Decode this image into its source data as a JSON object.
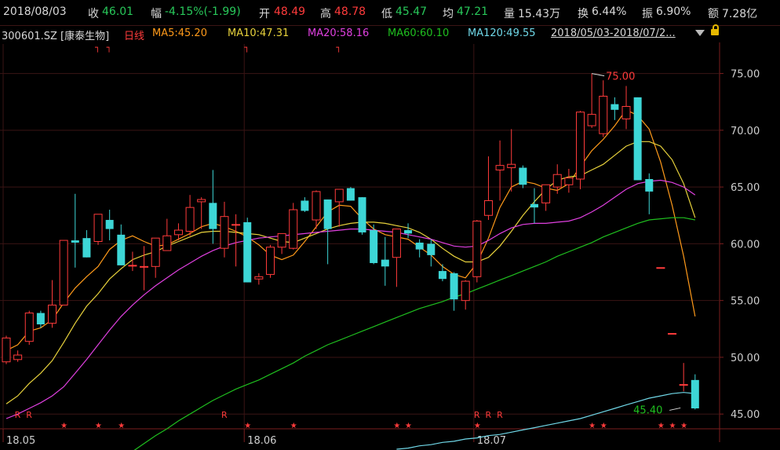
{
  "info": {
    "date": "2018/08/03",
    "close_label": "收",
    "close_value": "46.01",
    "change_label": "幅",
    "change_value": "-4.15%(-1.99)",
    "open_label": "开",
    "open_value": "48.49",
    "high_label": "高",
    "high_value": "48.78",
    "low_label": "低",
    "low_value": "45.47",
    "avg_label": "均",
    "avg_value": "47.21",
    "volume_label": "量",
    "volume_value": "15.43万",
    "turnover_label": "换",
    "turnover_value": "6.44%",
    "amplitude_label": "振",
    "amplitude_value": "6.90%",
    "amount_label": "额",
    "amount_value": "7.28亿"
  },
  "legend": {
    "stock": "300601.SZ [康泰生物]",
    "period": "日线",
    "ma5": "MA5:45.20",
    "ma10": "MA10:47.31",
    "ma20": "MA20:58.16",
    "ma60": "MA60:60.10",
    "ma120": "MA120:49.55",
    "range": "2018/05/03-2018/07/2..."
  },
  "colors": {
    "up": "#ff3b3b",
    "down": "#3dd6d6",
    "ma5": "#ff9a1a",
    "ma10": "#e8d23c",
    "ma20": "#e040e0",
    "ma60": "#1fbf1f",
    "ma120": "#70d8e8",
    "grid": "#3a1414",
    "axis": "#7a1e1e"
  },
  "chart_data": {
    "type": "candlestick",
    "y_ticks": [
      "75.00",
      "70.00",
      "65.00",
      "60.00",
      "55.00",
      "50.00",
      "45.00"
    ],
    "ylim": [
      43.7,
      77.6
    ],
    "x_ticks": [
      {
        "label": "18.05",
        "index": 0
      },
      {
        "label": "18.06",
        "index": 21
      },
      {
        "label": "18.07",
        "index": 41
      }
    ],
    "annotations": {
      "high": "75.00",
      "low": "45.40",
      "high_index": 51,
      "low_index": 59
    },
    "candles": [
      {
        "o": 49.6,
        "h": 51.9,
        "l": 49.4,
        "c": 51.7
      },
      {
        "o": 49.8,
        "h": 50.6,
        "l": 49.6,
        "c": 50.2
      },
      {
        "o": 51.4,
        "h": 54.1,
        "l": 51.1,
        "c": 53.9
      },
      {
        "o": 53.9,
        "h": 54.1,
        "l": 52.6,
        "c": 52.9
      },
      {
        "o": 53.0,
        "h": 56.8,
        "l": 52.6,
        "c": 54.6
      },
      {
        "o": 54.6,
        "h": 60.3,
        "l": 54.6,
        "c": 60.3
      },
      {
        "o": 60.3,
        "h": 64.4,
        "l": 57.9,
        "c": 60.1
      },
      {
        "o": 60.5,
        "h": 61.2,
        "l": 58.8,
        "c": 58.8
      },
      {
        "o": 60.2,
        "h": 62.6,
        "l": 59.9,
        "c": 62.6
      },
      {
        "o": 62.1,
        "h": 63.0,
        "l": 60.3,
        "c": 61.3
      },
      {
        "o": 60.8,
        "h": 61.7,
        "l": 58.1,
        "c": 58.1
      },
      {
        "o": 58.1,
        "h": 59.3,
        "l": 57.6,
        "c": 58.1
      },
      {
        "o": 58.0,
        "h": 59.8,
        "l": 55.9,
        "c": 58.0
      },
      {
        "o": 58.0,
        "h": 60.5,
        "l": 57.0,
        "c": 60.5
      },
      {
        "o": 59.4,
        "h": 62.2,
        "l": 59.4,
        "c": 60.7
      },
      {
        "o": 60.8,
        "h": 61.8,
        "l": 60.3,
        "c": 61.2
      },
      {
        "o": 61.1,
        "h": 64.3,
        "l": 60.7,
        "c": 63.2
      },
      {
        "o": 63.7,
        "h": 64.1,
        "l": 61.3,
        "c": 63.9
      },
      {
        "o": 63.6,
        "h": 66.5,
        "l": 60.0,
        "c": 61.3
      },
      {
        "o": 59.6,
        "h": 63.7,
        "l": 58.8,
        "c": 62.4
      },
      {
        "o": 61.7,
        "h": 62.6,
        "l": 58.0,
        "c": 61.7
      },
      {
        "o": 61.9,
        "h": 62.3,
        "l": 56.6,
        "c": 56.6
      },
      {
        "o": 56.9,
        "h": 57.4,
        "l": 56.4,
        "c": 57.1
      },
      {
        "o": 57.3,
        "h": 59.9,
        "l": 57.0,
        "c": 59.7
      },
      {
        "o": 59.7,
        "h": 60.9,
        "l": 59.1,
        "c": 60.9
      },
      {
        "o": 59.6,
        "h": 63.6,
        "l": 59.5,
        "c": 63.0
      },
      {
        "o": 63.8,
        "h": 64.1,
        "l": 62.8,
        "c": 62.9
      },
      {
        "o": 62.1,
        "h": 64.7,
        "l": 61.3,
        "c": 64.6
      },
      {
        "o": 63.9,
        "h": 63.9,
        "l": 58.2,
        "c": 61.3
      },
      {
        "o": 63.7,
        "h": 64.1,
        "l": 61.5,
        "c": 64.8
      },
      {
        "o": 64.9,
        "h": 65.0,
        "l": 63.8,
        "c": 63.8
      },
      {
        "o": 64.1,
        "h": 64.1,
        "l": 60.8,
        "c": 61.0
      },
      {
        "o": 61.2,
        "h": 61.7,
        "l": 58.2,
        "c": 58.3
      },
      {
        "o": 58.6,
        "h": 60.6,
        "l": 56.3,
        "c": 58.0
      },
      {
        "o": 58.8,
        "h": 61.3,
        "l": 56.2,
        "c": 61.3
      },
      {
        "o": 61.2,
        "h": 61.8,
        "l": 60.5,
        "c": 60.9
      },
      {
        "o": 60.1,
        "h": 60.4,
        "l": 58.8,
        "c": 59.5
      },
      {
        "o": 60.0,
        "h": 60.4,
        "l": 58.0,
        "c": 59.0
      },
      {
        "o": 57.6,
        "h": 58.2,
        "l": 56.7,
        "c": 56.9
      },
      {
        "o": 57.4,
        "h": 57.5,
        "l": 54.1,
        "c": 55.1
      },
      {
        "o": 55.0,
        "h": 56.8,
        "l": 54.2,
        "c": 56.7
      },
      {
        "o": 57.1,
        "h": 62.1,
        "l": 56.6,
        "c": 62.0
      },
      {
        "o": 62.5,
        "h": 67.7,
        "l": 62.1,
        "c": 63.8
      },
      {
        "o": 66.5,
        "h": 69.1,
        "l": 63.8,
        "c": 66.9
      },
      {
        "o": 66.7,
        "h": 70.1,
        "l": 64.6,
        "c": 67.0
      },
      {
        "o": 66.7,
        "h": 66.9,
        "l": 64.9,
        "c": 65.2
      },
      {
        "o": 63.5,
        "h": 64.9,
        "l": 61.8,
        "c": 63.2
      },
      {
        "o": 63.6,
        "h": 65.2,
        "l": 62.9,
        "c": 65.2
      },
      {
        "o": 65.0,
        "h": 67.0,
        "l": 64.4,
        "c": 66.1
      },
      {
        "o": 65.2,
        "h": 66.6,
        "l": 64.5,
        "c": 65.8
      },
      {
        "o": 65.7,
        "h": 71.7,
        "l": 64.8,
        "c": 71.6
      },
      {
        "o": 70.4,
        "h": 75.0,
        "l": 70.2,
        "c": 71.4
      },
      {
        "o": 69.7,
        "h": 74.4,
        "l": 69.4,
        "c": 73.0
      },
      {
        "o": 72.3,
        "h": 72.9,
        "l": 70.9,
        "c": 71.8
      },
      {
        "o": 71.0,
        "h": 73.9,
        "l": 70.1,
        "c": 72.1
      },
      {
        "o": 72.9,
        "h": 72.9,
        "l": 65.6,
        "c": 65.6
      },
      {
        "o": 65.7,
        "h": 66.2,
        "l": 62.6,
        "c": 64.6
      },
      {
        "o": 57.9,
        "h": 57.9,
        "l": 57.9,
        "c": 57.9
      },
      {
        "o": 52.1,
        "h": 52.1,
        "l": 52.1,
        "c": 52.1
      },
      {
        "o": 47.6,
        "h": 49.5,
        "l": 47.0,
        "c": 47.6
      },
      {
        "o": 48.0,
        "h": 48.5,
        "l": 45.4,
        "c": 45.5
      }
    ],
    "series": [
      {
        "name": "MA5",
        "values": [
          50.6,
          51.1,
          52.3,
          52.6,
          53.3,
          54.8,
          56.1,
          57.1,
          58.0,
          59.5,
          60.3,
          60.7,
          60.2,
          59.8,
          59.9,
          60.4,
          60.9,
          61.5,
          61.8,
          61.5,
          61.1,
          60.6,
          59.9,
          59.0,
          58.6,
          59.0,
          60.2,
          61.5,
          62.8,
          63.4,
          63.3,
          62.2,
          61.3,
          60.8,
          60.6,
          60.4,
          59.7,
          59.0,
          58.0,
          57.3,
          57.0,
          58.3,
          60.5,
          63.2,
          65.0,
          65.5,
          65.3,
          64.9,
          64.7,
          65.3,
          66.8,
          68.2,
          69.2,
          70.4,
          71.8,
          71.3,
          70.1,
          67.2,
          63.4,
          58.9,
          53.6
        ]
      },
      {
        "name": "MA10",
        "values": [
          45.9,
          46.6,
          47.7,
          48.6,
          49.7,
          51.3,
          53.0,
          54.5,
          55.6,
          56.9,
          57.8,
          58.6,
          59.0,
          59.3,
          59.8,
          60.2,
          60.6,
          61.0,
          61.1,
          61.1,
          61.0,
          60.9,
          60.8,
          60.5,
          60.2,
          60.1,
          60.5,
          60.9,
          61.3,
          61.6,
          61.8,
          61.9,
          61.9,
          61.8,
          61.6,
          61.4,
          61.0,
          60.4,
          59.6,
          58.9,
          58.4,
          58.4,
          58.8,
          59.8,
          61.1,
          62.5,
          63.7,
          64.8,
          65.6,
          65.9,
          66.0,
          66.5,
          67.0,
          67.8,
          68.6,
          69.0,
          69.0,
          68.6,
          67.4,
          65.3,
          62.3
        ]
      },
      {
        "name": "MA20",
        "values": [
          44.6,
          45.0,
          45.5,
          46.0,
          46.6,
          47.4,
          48.6,
          49.8,
          51.1,
          52.4,
          53.6,
          54.6,
          55.5,
          56.3,
          57.0,
          57.7,
          58.3,
          58.9,
          59.4,
          59.8,
          60.1,
          60.3,
          60.5,
          60.6,
          60.7,
          60.8,
          60.9,
          61.0,
          61.1,
          61.2,
          61.3,
          61.3,
          61.2,
          61.1,
          61.0,
          60.8,
          60.6,
          60.4,
          60.1,
          59.8,
          59.7,
          59.8,
          60.3,
          60.9,
          61.4,
          61.7,
          61.8,
          61.8,
          61.9,
          62.0,
          62.3,
          62.8,
          63.4,
          64.1,
          64.8,
          65.3,
          65.5,
          65.6,
          65.4,
          65.0,
          64.3
        ]
      },
      {
        "name": "MA60",
        "values": [
          null,
          null,
          null,
          null,
          null,
          null,
          null,
          null,
          null,
          null,
          null,
          41.7,
          42.4,
          43.1,
          43.7,
          44.4,
          45.0,
          45.6,
          46.2,
          46.7,
          47.2,
          47.6,
          48.0,
          48.5,
          49.0,
          49.5,
          50.1,
          50.6,
          51.1,
          51.5,
          51.9,
          52.3,
          52.7,
          53.1,
          53.5,
          53.9,
          54.3,
          54.6,
          54.9,
          55.3,
          55.6,
          56.0,
          56.4,
          56.8,
          57.2,
          57.6,
          58.0,
          58.4,
          58.9,
          59.3,
          59.7,
          60.1,
          60.6,
          61.0,
          61.4,
          61.8,
          62.1,
          62.2,
          62.3,
          62.3,
          62.1
        ]
      },
      {
        "name": "MA120",
        "values": [
          null,
          null,
          null,
          null,
          null,
          null,
          null,
          null,
          null,
          null,
          null,
          null,
          null,
          null,
          null,
          null,
          null,
          null,
          null,
          null,
          null,
          null,
          null,
          null,
          null,
          null,
          null,
          null,
          null,
          null,
          null,
          null,
          null,
          null,
          41.9,
          42.0,
          42.2,
          42.3,
          42.5,
          42.6,
          42.8,
          42.9,
          43.1,
          43.2,
          43.4,
          43.6,
          43.8,
          44.0,
          44.2,
          44.4,
          44.6,
          44.9,
          45.2,
          45.5,
          45.8,
          46.1,
          46.4,
          46.6,
          46.8,
          46.9,
          46.8
        ]
      }
    ],
    "signals_top": [
      {
        "index": 8,
        "text": "┐"
      },
      {
        "index": 9,
        "text": "┐"
      },
      {
        "index": 21,
        "text": "┐"
      },
      {
        "index": 29,
        "text": "┐"
      }
    ],
    "signals_bottom_r": [
      1,
      2,
      19,
      41,
      42,
      43
    ],
    "signals_bottom_star": [
      5,
      8,
      10,
      21,
      25,
      34,
      35,
      41,
      51,
      52,
      57,
      58,
      59
    ]
  }
}
